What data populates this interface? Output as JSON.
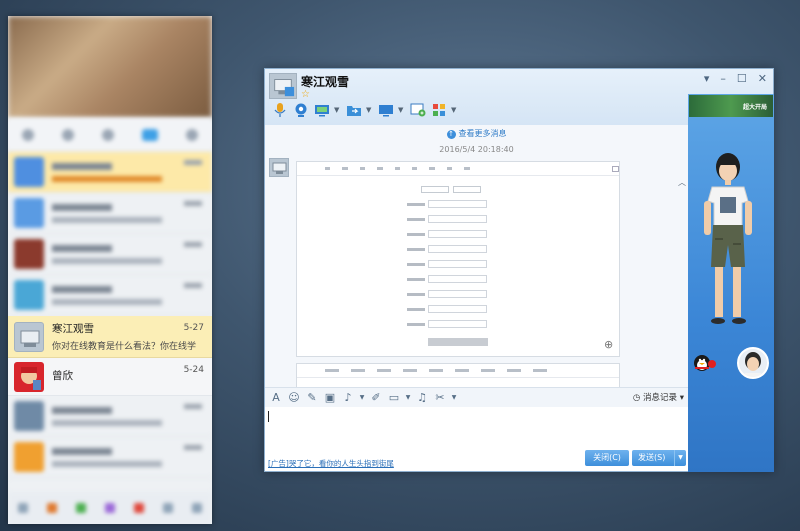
{
  "contacts": {
    "selected": {
      "name": "寒江观雪",
      "preview": "你对在线教育是什么看法？你在线学",
      "date": "5-27"
    },
    "next": {
      "name": "曾欣",
      "date": "5-24"
    }
  },
  "chat": {
    "title": "寒江观雪",
    "star": "☆",
    "window_controls": [
      "▾",
      "–",
      "☐",
      "✕"
    ],
    "view_more": "查看更多消息",
    "timestamp": "2016/5/4 20:18:40",
    "history_label": "消息记录",
    "ad_text": "[广告]哭了它，看你的人生头指到街尾",
    "close_button": "关闭(C)",
    "send_button": "发送(S)",
    "toolbar_icons": [
      "microphone-icon",
      "webcam-icon",
      "screen-share-icon",
      "folder-transfer-icon",
      "remote-desktop-icon",
      "group-chat-icon",
      "apps-icon"
    ],
    "input_icons": [
      "font-icon",
      "emoji-icon",
      "magic-icon",
      "shake-icon",
      "voice-icon",
      "edit-icon",
      "image-icon",
      "music-icon",
      "screenshot-icon"
    ]
  },
  "side_panel": {
    "ad_banner_text": "超大开局"
  },
  "colors": {
    "accent": "#3d8fdb",
    "link": "#2e7bc7",
    "side_panel": "#3b86d6",
    "highlight": "#fbeeb6"
  }
}
